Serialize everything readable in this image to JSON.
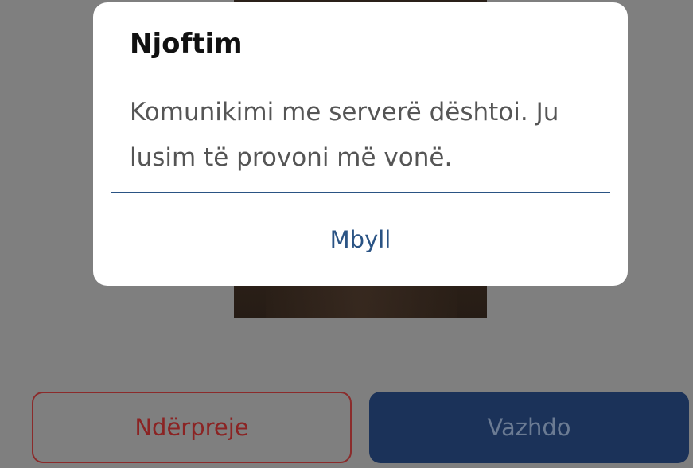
{
  "dialog": {
    "title": "Njoftim",
    "message": "Komunikimi me serverë dështoi. Ju lusim të provoni më vonë.",
    "close_label": "Mbyll"
  },
  "buttons": {
    "cancel_label": "Ndërpreje",
    "continue_label": "Vazhdo"
  },
  "colors": {
    "overlay": "#7f7f7f",
    "dialog_bg": "#ffffff",
    "accent": "#2a5384",
    "cancel": "#8b2323",
    "continue_bg": "#1b3259"
  }
}
